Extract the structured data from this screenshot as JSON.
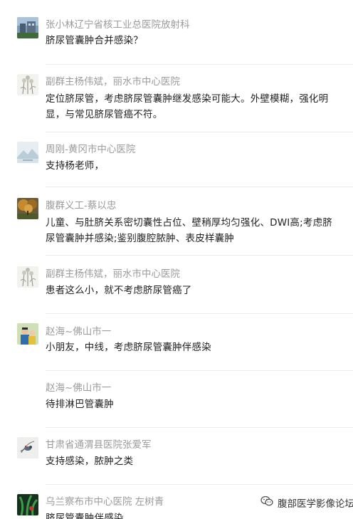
{
  "comments": [
    {
      "author": "张小林辽宁省核工业总医院放射科",
      "text": "脐尿管囊肿合并感染？",
      "avatar": "building-photo-avatar"
    },
    {
      "author": "副群主杨伟斌，丽水市中心医院",
      "text": "定位脐尿管，考虑脐尿管囊肿继发感染可能大。外壁模糊，强化明显，与常见脐尿管癌不符。",
      "avatar": "flower-sketch-avatar"
    },
    {
      "author": "周刚-黄冈市中心医院",
      "text": "支持杨老师，",
      "avatar": "mountain-landscape-avatar"
    },
    {
      "author": "腹群义工-蔡以忠",
      "text": "儿童、与肚脐关系密切囊性占位、壁稍厚均匀强化、DWI高;考虑脐尿管囊肿并感染;鉴别腹腔脓肿、表皮样囊肿",
      "avatar": "autumn-tree-avatar"
    },
    {
      "author": "副群主杨伟斌，丽水市中心医院",
      "text": "患者这么小，就不考虑脐尿管癌了",
      "avatar": "flower-sketch-avatar"
    },
    {
      "author": "赵海~佛山市一",
      "text": "小朋友，中线，考虑脐尿管囊肿伴感染",
      "avatar": "people-photo-avatar"
    },
    {
      "author": "赵海~佛山市一",
      "text": "待排淋巴管囊肿",
      "avatar": ""
    },
    {
      "author": "甘肃省通渭县医院张爱军",
      "text": "支持感染，脓肿之类",
      "avatar": "bird-sketch-avatar"
    },
    {
      "author": "乌兰察布市中心医院 左树青",
      "text": "脐尿管囊肿伴感染",
      "avatar": "green-plant-avatar"
    }
  ],
  "watermark": {
    "text": "腹部医学影像论坛",
    "icon": "wechat-icon"
  }
}
